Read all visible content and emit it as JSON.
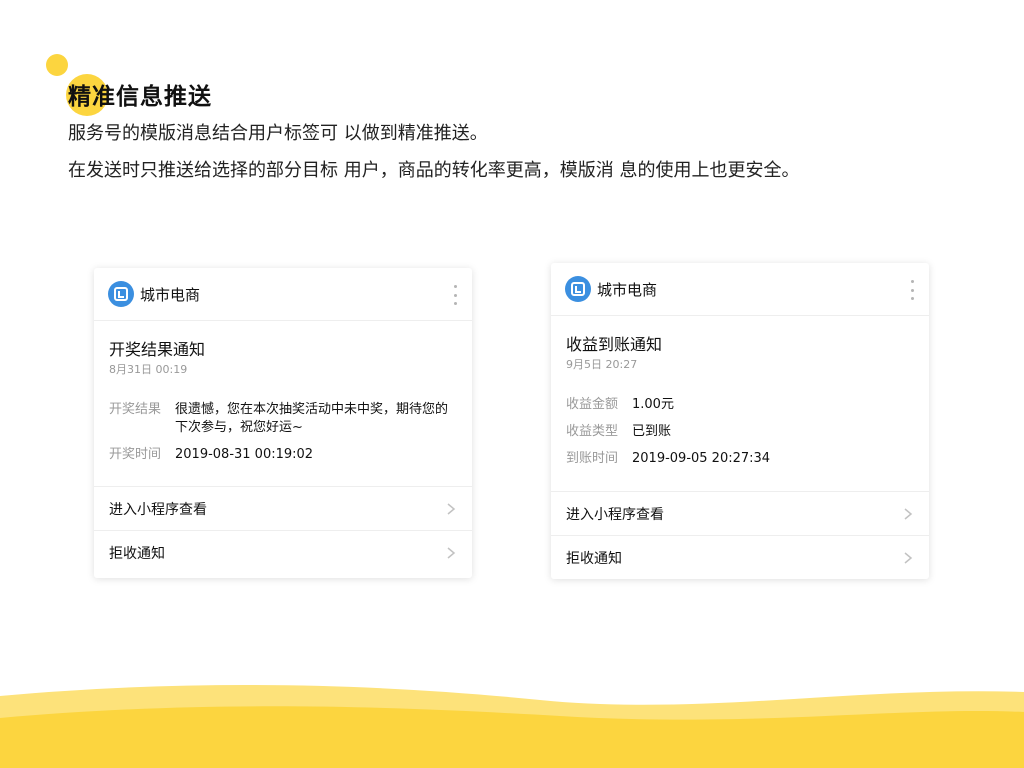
{
  "header": {
    "title": "精准信息推送",
    "line1": "服务号的模版消息结合用户标签可 以做到精准推送。",
    "line2": "在发送时只推送给选择的部分目标 用户，商品的转化率更高，模版消 息的使用上也更安全。"
  },
  "colors": {
    "accent": "#fcd53f",
    "brand_blue": "#3b8fe0"
  },
  "card_left": {
    "brand": "城市电商",
    "title": "开奖结果通知",
    "date": "8月31日  00:19",
    "fields": [
      {
        "label": "开奖结果",
        "value": "很遗憾，您在本次抽奖活动中未中奖，期待您的下次参与，祝您好运~"
      },
      {
        "label": "开奖时间",
        "value": "2019-08-31 00:19:02"
      }
    ],
    "actions": [
      "进入小程序查看",
      "拒收通知"
    ]
  },
  "card_right": {
    "brand": "城市电商",
    "title": "收益到账通知",
    "date": "9月5日  20:27",
    "fields": [
      {
        "label": "收益金额",
        "value": "1.00元"
      },
      {
        "label": "收益类型",
        "value": "已到账"
      },
      {
        "label": "到账时间",
        "value": "2019-09-05 20:27:34"
      }
    ],
    "actions": [
      "进入小程序查看",
      "拒收通知"
    ]
  },
  "icons": {
    "brand_logo": "brand-logo-icon",
    "more": "more-vertical-icon",
    "chevron": "chevron-right-icon"
  }
}
